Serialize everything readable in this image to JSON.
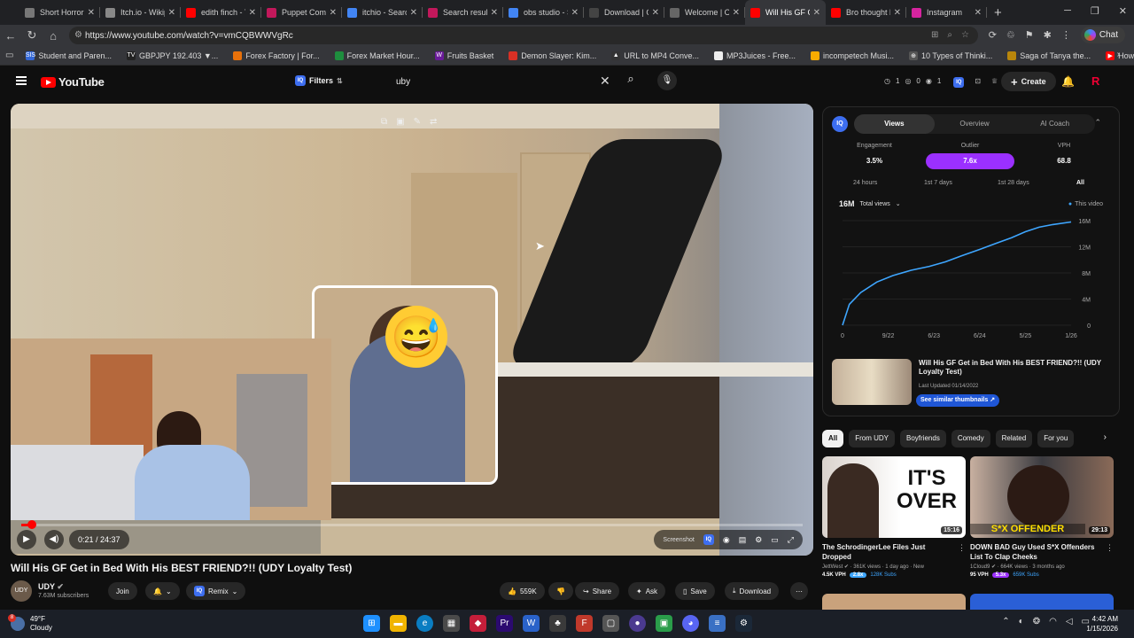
{
  "browser": {
    "tabs": [
      {
        "title": "Short Horror G",
        "color": "#777"
      },
      {
        "title": "Itch.io - Wikipe",
        "color": "#888"
      },
      {
        "title": "edith finch - Yo",
        "color": "#ff0000"
      },
      {
        "title": "Puppet Combo",
        "color": "#c2185b"
      },
      {
        "title": "itchio - Search",
        "color": "#4285f4"
      },
      {
        "title": "Search results",
        "color": "#c2185b"
      },
      {
        "title": "obs studio - Se",
        "color": "#4285f4"
      },
      {
        "title": "Download | Ob",
        "color": "#444"
      },
      {
        "title": "Welcome | OBS",
        "color": "#666"
      },
      {
        "title": "Will His GF Get",
        "color": "#ff0000",
        "active": true
      },
      {
        "title": "Bro thought he",
        "color": "#ff0000"
      },
      {
        "title": "Instagram",
        "color": "#d6249f"
      }
    ],
    "new_tab": "+",
    "url": "https://www.youtube.com/watch?v=vmCQBWWVgRc",
    "chat_label": "Chat",
    "profile_letter": "R",
    "bookmarks": [
      {
        "label": "Student and Paren...",
        "color": "#3367d6",
        "mark": "SIS"
      },
      {
        "label": "GBPJPY 192.403 ▼...",
        "color": "#222",
        "mark": "TV"
      },
      {
        "label": "Forex Factory | For...",
        "color": "#e8710a",
        "mark": ""
      },
      {
        "label": "Forex Market Hour...",
        "color": "#1e8e3e",
        "mark": ""
      },
      {
        "label": "Fruits Basket",
        "color": "#6a1b9a",
        "mark": "W"
      },
      {
        "label": "Demon Slayer: Kim...",
        "color": "#d93025",
        "mark": ""
      },
      {
        "label": "URL to MP4 Conve...",
        "color": "#333",
        "mark": "▲"
      },
      {
        "label": "MP3Juices - Free...",
        "color": "#eee",
        "mark": ""
      },
      {
        "label": "incompetech Musi...",
        "color": "#f9ab00",
        "mark": ""
      },
      {
        "label": "10 Types of Thinki...",
        "color": "#555",
        "mark": "⊕"
      },
      {
        "label": "Saga of Tanya the...",
        "color": "#b8860b",
        "mark": ""
      },
      {
        "label": "How to Fix Screen...",
        "color": "#ff0000",
        "mark": "▶"
      }
    ]
  },
  "youtube": {
    "logo_text": "YouTube",
    "filters_label": "Filters",
    "search_value": "uby",
    "counters": [
      "1",
      "0",
      "1"
    ],
    "create_label": "Create"
  },
  "player": {
    "current_time": "0:21",
    "duration": "24:37",
    "time_display": "0:21 / 24:37",
    "progress_fraction": 0.014,
    "screenshot_label": "Screenshot",
    "emoji": "😅"
  },
  "video": {
    "title": "Will His GF Get in Bed With His BEST FRIEND?!! (UDY Loyalty Test)",
    "channel_name": "UDY",
    "channel_avatar_label": "UDY",
    "subscribers": "7.63M subscribers",
    "join_label": "Join",
    "remix_label": "Remix",
    "likes": "559K",
    "share_label": "Share",
    "ask_label": "Ask",
    "save_label": "Save",
    "download_label": "Download"
  },
  "analytics": {
    "tabs": [
      "Views",
      "Overview",
      "AI Coach"
    ],
    "active_tab": "Views",
    "engagement_label": "Engagement",
    "engagement_value": "3.5%",
    "outlier_label": "Outlier",
    "outlier_value": "7.6x",
    "vph_label": "VPH",
    "vph_value": "68.8",
    "ranges": [
      "24 hours",
      "1st 7 days",
      "1st 28 days",
      "All"
    ],
    "active_range": "All",
    "total_value": "16M",
    "total_label": "Total views",
    "legend_label": "This video",
    "related_title": "Will His GF Get in Bed With His BEST FRIEND?!! (UDY Loyalty Test)",
    "related_date": "Last Updated 01/14/2022",
    "similar_label": "See similar thumbnails ↗"
  },
  "chart_data": {
    "type": "line",
    "x_ticks": [
      "0",
      "9/22",
      "6/23",
      "6/24",
      "5/25",
      "1/26"
    ],
    "y_ticks": [
      "16M",
      "12M",
      "8M",
      "4M",
      "0"
    ],
    "ylim": [
      0,
      16
    ],
    "series": [
      {
        "name": "This video",
        "color": "#3ea6ff",
        "x": [
          0,
          0.03,
          0.08,
          0.15,
          0.22,
          0.3,
          0.38,
          0.45,
          0.52,
          0.6,
          0.67,
          0.74,
          0.8,
          0.86,
          0.92,
          1.0
        ],
        "y": [
          0,
          3.2,
          5.0,
          6.6,
          7.6,
          8.4,
          9.0,
          9.7,
          10.6,
          11.6,
          12.5,
          13.4,
          14.3,
          15.0,
          15.4,
          15.8
        ]
      }
    ]
  },
  "recs": {
    "chips": [
      "All",
      "From UDY",
      "Boyfriends",
      "Comedy",
      "Related",
      "For you"
    ],
    "videos": [
      {
        "title": "The SchrodingerLee Files Just Dropped",
        "channel": "JettWest",
        "views": "361K views · 1 day ago · New",
        "duration": "15:16",
        "overlay": "IT'S OVER",
        "vph": "4.5K VPH",
        "outlier": "2.8x",
        "subs": "128K Subs"
      },
      {
        "title": "DOWN BAD Guy Used S*X Offenders List To Clap Cheeks",
        "channel": "1Cloud9",
        "views": "664K views · 3 months ago",
        "duration": "29:13",
        "overlay": "S*X OFFENDER",
        "vph": "95 VPH",
        "outlier": "5.3x",
        "subs": "659K Subs"
      }
    ]
  },
  "taskbar": {
    "temperature": "49°F",
    "condition": "Cloudy",
    "weather_badge": "8",
    "time": "4:42 AM",
    "date": "1/15/2026"
  }
}
